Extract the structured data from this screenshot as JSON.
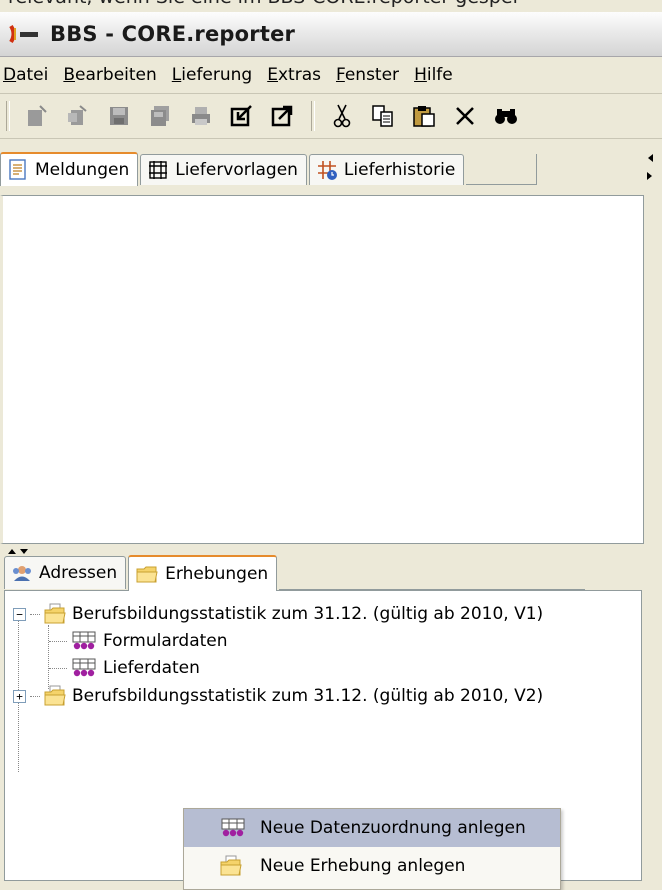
{
  "background_text": "relevant, wenn Sie eine im BBS-CORE.reporter gespei",
  "window": {
    "title": "BBS - CORE.reporter",
    "icon": "java-cup-icon"
  },
  "menubar": {
    "items": [
      {
        "label": "Datei",
        "mnemonic": "D"
      },
      {
        "label": "Bearbeiten",
        "mnemonic": "B"
      },
      {
        "label": "Lieferung",
        "mnemonic": "L"
      },
      {
        "label": "Extras",
        "mnemonic": "E"
      },
      {
        "label": "Fenster",
        "mnemonic": "F"
      },
      {
        "label": "Hilfe",
        "mnemonic": "H"
      }
    ]
  },
  "toolbar": {
    "buttons": [
      "new-doc-icon",
      "new-copy-icon",
      "save-icon",
      "save-all-icon",
      "print-icon",
      "import-icon",
      "export-icon",
      "cut-icon",
      "copy-icon",
      "paste-icon",
      "delete-icon",
      "find-icon"
    ]
  },
  "upper_tabs": [
    {
      "label": "Meldungen",
      "icon": "document-icon",
      "active": true
    },
    {
      "label": "Liefervorlagen",
      "icon": "grid-icon",
      "active": false
    },
    {
      "label": "Lieferhistorie",
      "icon": "grid-history-icon",
      "active": false
    }
  ],
  "lower_tabs": [
    {
      "label": "Adressen",
      "icon": "people-icon",
      "active": false
    },
    {
      "label": "Erhebungen",
      "icon": "folder-icon",
      "active": true
    }
  ],
  "tree": [
    {
      "label": "Berufsbildungsstatistik zum 31.12. (gültig ab 2010, V1)",
      "expanded": true,
      "children": [
        {
          "label": "Formulardaten"
        },
        {
          "label": "Lieferdaten"
        }
      ]
    },
    {
      "label": "Berufsbildungsstatistik zum 31.12. (gültig ab 2010, V2)",
      "expanded": false,
      "children": []
    }
  ],
  "context_menu": {
    "items": [
      {
        "label": "Neue Datenzuordnung anlegen",
        "icon": "data-mapping-icon",
        "highlighted": true
      },
      {
        "label": "Neue Erhebung anlegen",
        "icon": "folder-doc-icon",
        "highlighted": false
      }
    ]
  },
  "colors": {
    "window_bg": "#ece9d8",
    "active_tab_accent": "#e68b2c",
    "menu_highlight": "#b6bdd2",
    "data_icon_purple": "#a020a0"
  }
}
